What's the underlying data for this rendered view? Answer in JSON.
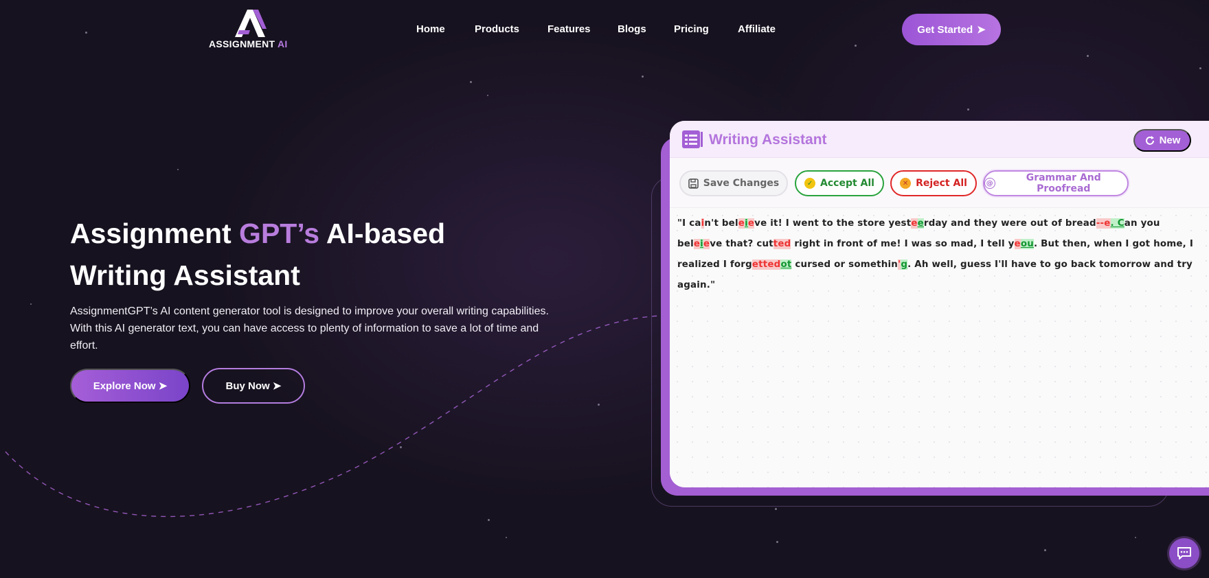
{
  "brand": {
    "name": "ASSIGNMENT",
    "suffix": "AI",
    "logo_icon": "a-monogram-logo"
  },
  "nav": {
    "items": [
      "Home",
      "Products",
      "Features",
      "Blogs",
      "Pricing",
      "Affiliate"
    ],
    "cta_label": "Get Started"
  },
  "hero": {
    "title_part1": "Assignment ",
    "title_accent": "GPT’s",
    "title_part2": " AI-based",
    "title_line2": "Writing Assistant",
    "description": "AssignmentGPT’s AI content generator tool is designed to improve your overall writing capabilities. With this AI generator text, you can have access to plenty of information to save a lot of time and effort.",
    "explore_label": "Explore Now",
    "buy_label": "Buy Now"
  },
  "assistant": {
    "title": "Writing Assistant",
    "new_label": "New",
    "toolbar": {
      "save": "Save Changes",
      "accept": "Accept All",
      "reject": "Reject All",
      "grammar": "Grammar And Proofread"
    },
    "segments": [
      {
        "t": "\"I ca",
        "k": "n"
      },
      {
        "t": "i",
        "k": "d"
      },
      {
        "t": "n't bel",
        "k": "n"
      },
      {
        "t": "e",
        "k": "d"
      },
      {
        "t": "i",
        "k": "i"
      },
      {
        "t": "e",
        "k": "d"
      },
      {
        "t": "ve it! I went to the store yest",
        "k": "n"
      },
      {
        "t": "e",
        "k": "d"
      },
      {
        "t": "e",
        "k": "i"
      },
      {
        "t": "rday and they were out of bread",
        "k": "n"
      },
      {
        "t": "--e",
        "k": "d"
      },
      {
        "t": ". C",
        "k": "i"
      },
      {
        "t": "an you bel",
        "k": "n"
      },
      {
        "t": "e",
        "k": "d"
      },
      {
        "t": "i",
        "k": "i"
      },
      {
        "t": "e",
        "k": "d"
      },
      {
        "t": "ve that? cut",
        "k": "n"
      },
      {
        "t": "ted",
        "k": "d"
      },
      {
        "t": " right in front of me! I was so mad, I tell y",
        "k": "n"
      },
      {
        "t": "e",
        "k": "d"
      },
      {
        "t": "ou",
        "k": "i"
      },
      {
        "t": ". But then, when I got home, I realized I forg",
        "k": "n"
      },
      {
        "t": "etted",
        "k": "d"
      },
      {
        "t": "ot",
        "k": "i"
      },
      {
        "t": " cursed or somethin",
        "k": "n"
      },
      {
        "t": "'",
        "k": "d"
      },
      {
        "t": "g",
        "k": "i"
      },
      {
        "t": ". Ah well, guess I'll have to go back tomorrow and try again.\"",
        "k": "n"
      }
    ]
  },
  "colors": {
    "background": "#17121f",
    "accent": "#b474dd",
    "accept": "#2aa33d",
    "reject": "#e02828"
  },
  "icons": [
    "a-monogram-logo",
    "arrow-right-icon",
    "notebook-icon",
    "refresh-icon",
    "floppy-disk-icon",
    "check-circle-icon",
    "x-circle-icon",
    "at-sign-icon",
    "chat-icon"
  ]
}
